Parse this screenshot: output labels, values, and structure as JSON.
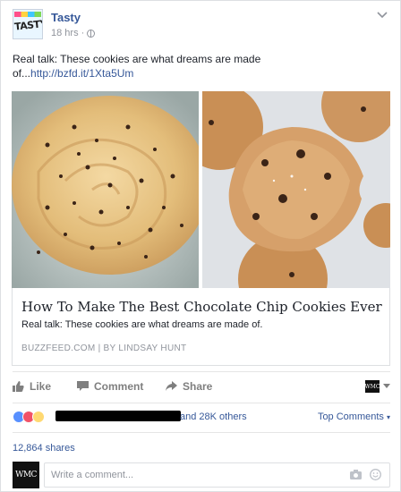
{
  "page": {
    "name": "Tasty",
    "logo_text": "TASTY",
    "time": "18 hrs",
    "separator": "·"
  },
  "post": {
    "text_prefix": "Real talk: These cookies are what dreams are made of...",
    "link": "http://bzfd.it/1Xta5Um"
  },
  "link_card": {
    "title": "How To Make The Best Chocolate Chip Cookies Ever",
    "description": "Real talk: These cookies are what dreams are made of.",
    "source": "BUZZFEED.COM | BY LINDSAY HUNT"
  },
  "actions": {
    "like": "Like",
    "comment": "Comment",
    "share": "Share",
    "page_selector_label": "WMC"
  },
  "reactions": {
    "icons": [
      "like-icon",
      "love-icon",
      "wow-icon"
    ],
    "others_text": "and 28K others",
    "top_comments": "Top Comments"
  },
  "shares": {
    "text": "12,864 shares"
  },
  "comment_box": {
    "avatar_label": "WMC",
    "placeholder": "Write a comment..."
  },
  "colors": {
    "link_blue": "#365899",
    "meta_grey": "#90949c",
    "like_blue": "#5890ff",
    "love_red": "#f25268",
    "wow_yellow": "#ffd972"
  }
}
